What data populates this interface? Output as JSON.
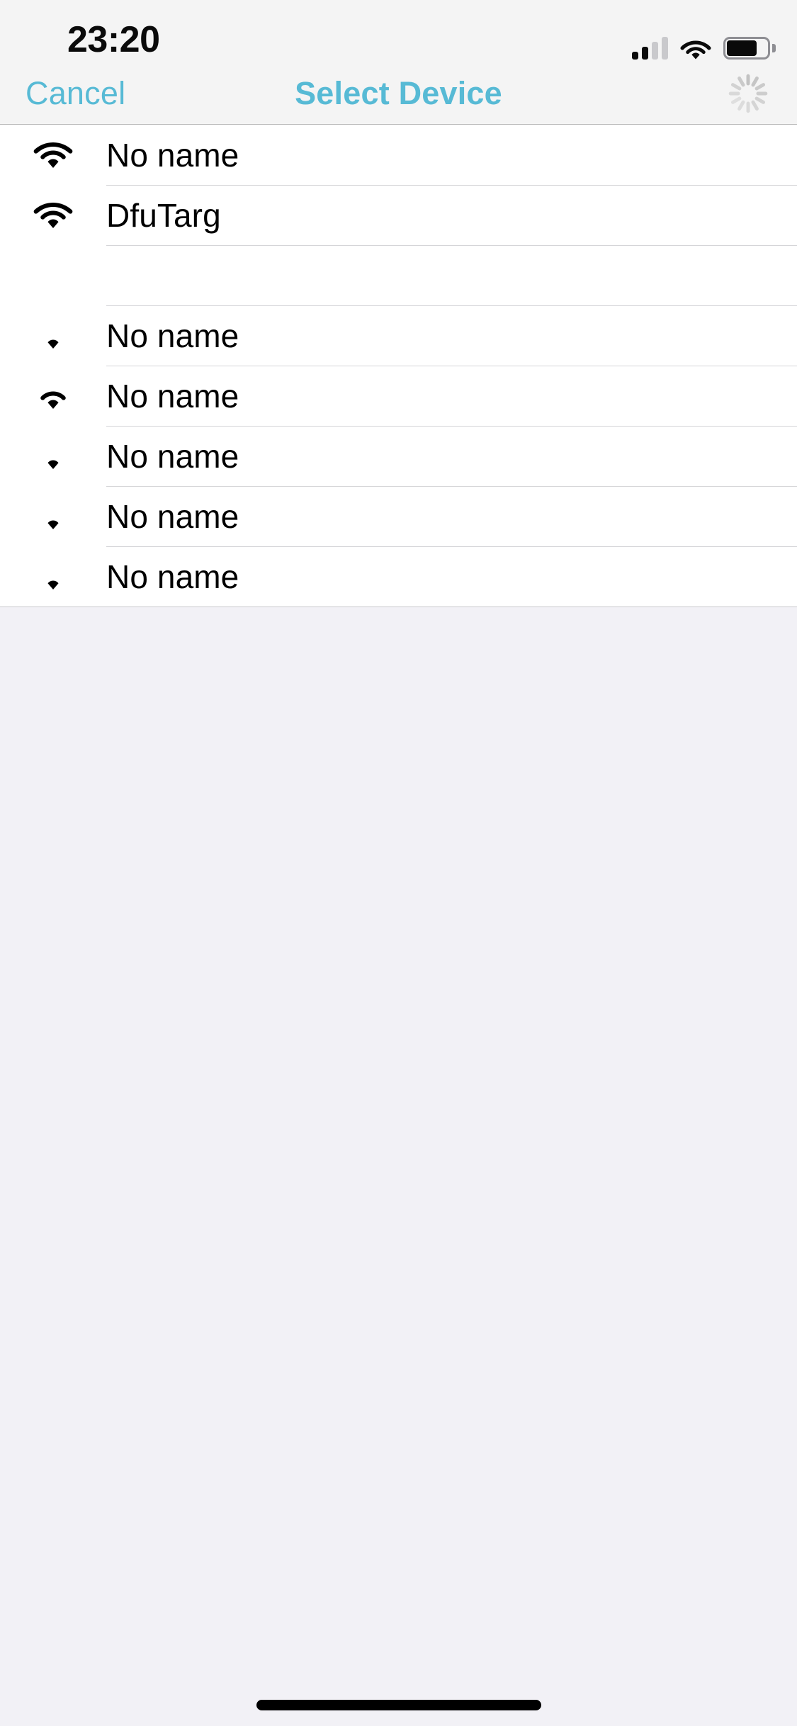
{
  "status_bar": {
    "time": "23:20",
    "cellular_icon": "cellular-bars-icon",
    "cellular_bars_filled": 2,
    "cellular_bars_total": 4,
    "wifi_icon": "wifi-icon",
    "battery_icon": "battery-icon",
    "battery_level_percent": 85
  },
  "nav_bar": {
    "cancel_label": "Cancel",
    "title": "Select Device",
    "spinner_icon": "activity-indicator-icon",
    "tint_color": "#57BAD5",
    "background_color": "#F4F4F4"
  },
  "device_list": {
    "rows": [
      {
        "name": "No name",
        "signal_icon": "signal-strength-3-icon",
        "signal_arcs": 3,
        "redacted": false
      },
      {
        "name": "DfuTarg",
        "signal_icon": "signal-strength-3-icon",
        "signal_arcs": 3,
        "redacted": false
      },
      {
        "name": "",
        "signal_icon": "signal-strength-0-icon",
        "signal_arcs": 0,
        "redacted": true
      },
      {
        "name": "No name",
        "signal_icon": "signal-strength-0-icon",
        "signal_arcs": 0,
        "redacted": false
      },
      {
        "name": "No name",
        "signal_icon": "signal-strength-1-icon",
        "signal_arcs": 1,
        "redacted": false
      },
      {
        "name": "No name",
        "signal_icon": "signal-strength-0-icon",
        "signal_arcs": 0,
        "redacted": false
      },
      {
        "name": "No name",
        "signal_icon": "signal-strength-0-icon",
        "signal_arcs": 0,
        "redacted": false
      },
      {
        "name": "No name",
        "signal_icon": "signal-strength-0-icon",
        "signal_arcs": 0,
        "redacted": false
      }
    ],
    "row_background_color": "#FFFFFF",
    "separator_color": "#D5D5D8"
  },
  "page_background_color": "#F2F1F6",
  "home_indicator": "home-indicator"
}
